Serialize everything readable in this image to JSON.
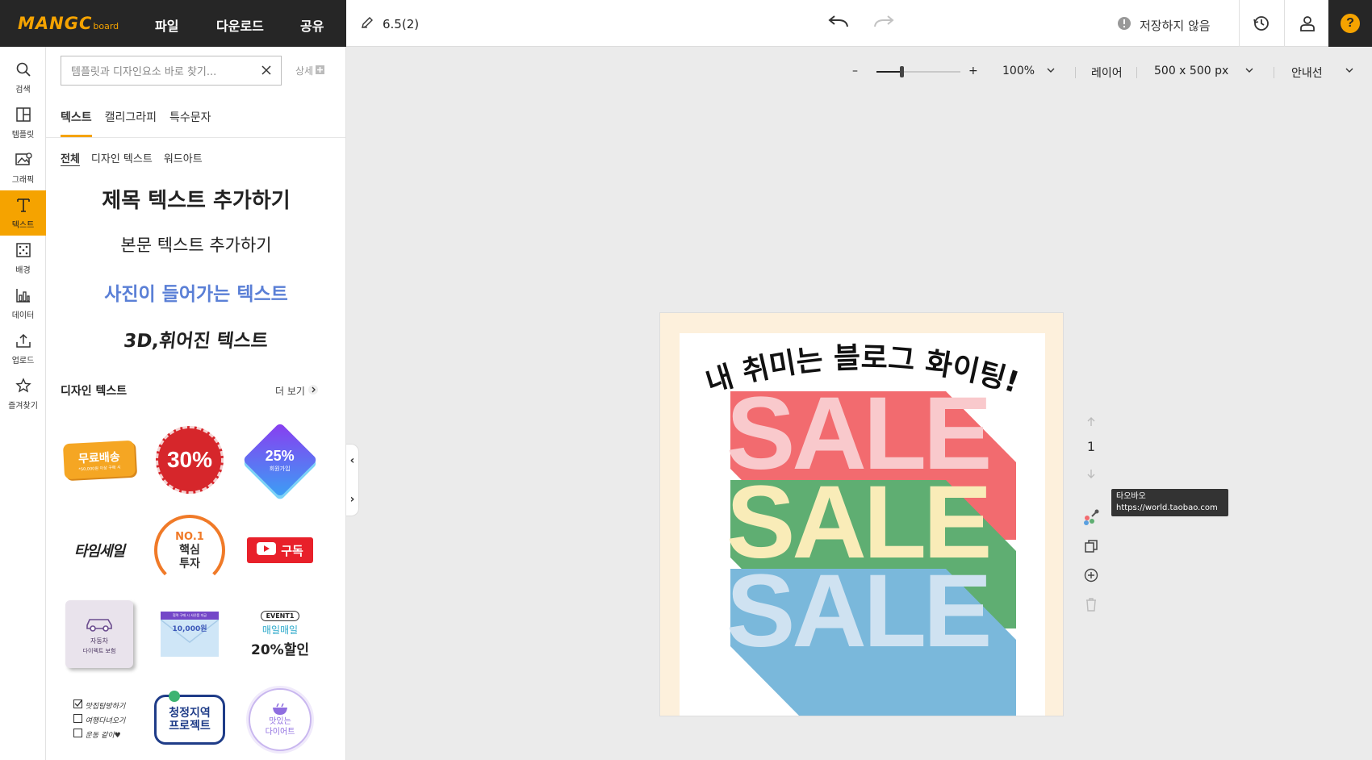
{
  "header": {
    "logo": "MANGC",
    "logo_sub": "board",
    "menu": [
      "파일",
      "다운로드",
      "공유"
    ],
    "doc_title": "6.5(2)",
    "save_status": "저장하지 않음",
    "help": "?"
  },
  "leftnav": {
    "items": [
      {
        "label": "검색",
        "icon": "search-icon"
      },
      {
        "label": "템플릿",
        "icon": "template-icon"
      },
      {
        "label": "그래픽",
        "icon": "graphic-icon"
      },
      {
        "label": "텍스트",
        "icon": "text-icon",
        "active": true
      },
      {
        "label": "배경",
        "icon": "background-icon"
      },
      {
        "label": "데이터",
        "icon": "chart-icon"
      },
      {
        "label": "업로드",
        "icon": "upload-icon"
      },
      {
        "label": "즐겨찾기",
        "icon": "star-icon"
      }
    ]
  },
  "panel": {
    "search_placeholder": "템플릿과 디자인요소 바로 찾기...",
    "detail_label": "상세",
    "tabs": [
      "텍스트",
      "캘리그라피",
      "특수문자"
    ],
    "subtabs": [
      "전체",
      "디자인 텍스트",
      "워드아트"
    ],
    "add_title": "제목 텍스트 추가하기",
    "add_body": "본문 텍스트 추가하기",
    "add_photo": "사진이 들어가는 텍스트",
    "add_3d": "3D,휘어진 텍스트",
    "design_text_header": "디자인 텍스트",
    "more_label": "더 보기",
    "thumbs": {
      "free_ship": "무료배송",
      "free_ship_sub": "*50,000원 이상 구매 시",
      "pct30": "30%",
      "pct25": "25%",
      "pct25_sub": "회원가입",
      "timesale": "타임세일",
      "no1_a": "NO.1",
      "no1_b": "핵심",
      "no1_c": "투자",
      "subscribe": "구독",
      "car_a": "자동차",
      "car_b": "다이렉트 보험",
      "env_top": "협력 구매 시 사은품 지급",
      "env_amount": "10,000원",
      "event_tag": "EVENT1",
      "event_a": "매일매일",
      "event_b": "20%할인",
      "check_a": "맛집탐방하기",
      "check_b": "여행다녀오기",
      "check_c": "운동 같이♥",
      "clean_a": "청정지역",
      "clean_b": "프로젝트",
      "diet_a": "맛있는",
      "diet_b": "다이어트"
    }
  },
  "toolbar": {
    "zoom_minus": "–",
    "zoom_plus": "+",
    "zoom_fraction": 0.3,
    "zoom_value": "100%",
    "layers": "레이어",
    "size": "500 x 500 px",
    "guide": "안내선"
  },
  "canvas": {
    "headline": "내 취미는 블로그 화이팅!",
    "sale_word": "SALE",
    "colors": {
      "bg": "#fdf0dc",
      "sale1": "#f9c9cc",
      "shadow1": "#f26b6f",
      "sale2": "#f9ecb8",
      "shadow2": "#5fae72",
      "sale3": "#cfe2f1",
      "shadow3": "#7ab8db"
    }
  },
  "page_controls": {
    "page_number": "1"
  },
  "tooltip": {
    "title": "타오바오",
    "url": "https://world.taobao.com"
  }
}
